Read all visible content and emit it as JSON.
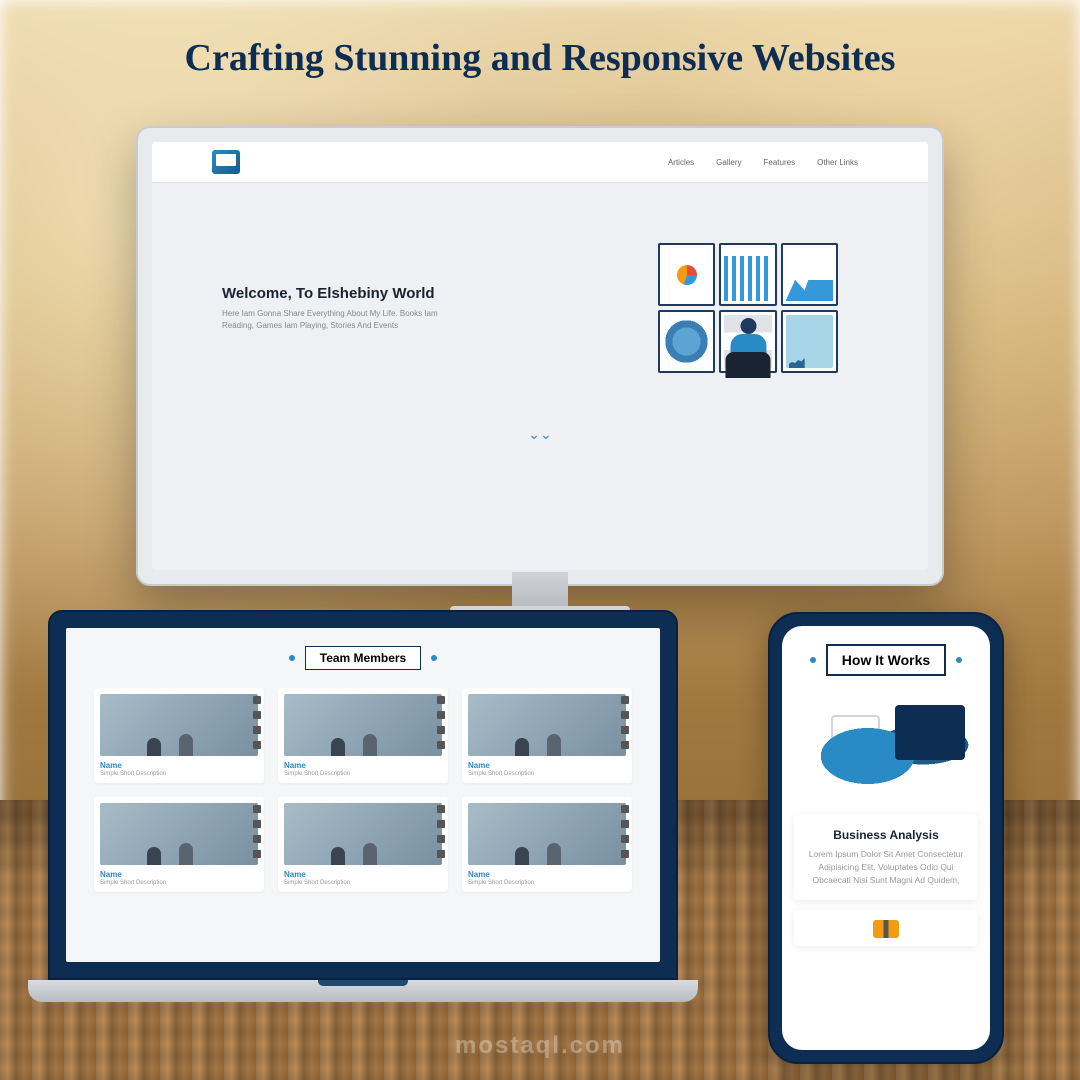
{
  "headline": "Crafting Stunning and Responsive Websites",
  "nav": {
    "items": [
      "Articles",
      "Gallery",
      "Features",
      "Other Links"
    ]
  },
  "hero": {
    "title": "Welcome, To Elshebiny World",
    "subtitle": "Here Iam Gonna Share Everything About My Life. Books Iam Reading, Games Iam Playing, Stories And Events"
  },
  "scroll_hint": "⌄⌄",
  "team": {
    "section_title": "Team Members",
    "members": [
      {
        "name": "Name",
        "desc": "Simple Short Description"
      },
      {
        "name": "Name",
        "desc": "Simple Short Description"
      },
      {
        "name": "Name",
        "desc": "Simple Short Description"
      },
      {
        "name": "Name",
        "desc": "Simple Short Description"
      },
      {
        "name": "Name",
        "desc": "Simple Short Description"
      },
      {
        "name": "Name",
        "desc": "Simple Short Description"
      }
    ]
  },
  "phone": {
    "section_title": "How It Works",
    "card_title": "Business Analysis",
    "card_text": "Lorem Ipsum Dolor Sit Amet Consectetur Adipisicing Elit. Voluptates Odio Qui Obcaecati Nisi Sunt Magni Ad Quidem,"
  },
  "watermark": "mostaql.com"
}
